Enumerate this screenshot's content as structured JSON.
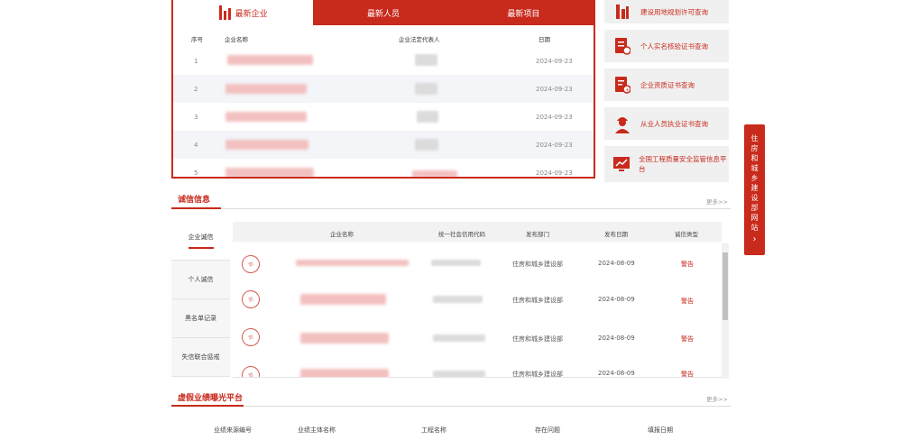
{
  "tabs": [
    {
      "label": "最新企业",
      "active": true
    },
    {
      "label": "最新人员",
      "active": false
    },
    {
      "label": "最新项目",
      "active": false
    }
  ],
  "latest_table": {
    "headers": {
      "no": "序号",
      "name": "企业名称",
      "rep": "企业法定代表人",
      "date": "日期"
    },
    "rows": [
      {
        "no": "1",
        "date": "2024-09-23"
      },
      {
        "no": "2",
        "date": "2024-09-23"
      },
      {
        "no": "3",
        "date": "2024-09-23"
      },
      {
        "no": "4",
        "date": "2024-09-23"
      },
      {
        "no": "5",
        "date": "2024-09-23"
      }
    ]
  },
  "side_cards": [
    {
      "text": "建设用地规划许可查询",
      "icon": "building-icon"
    },
    {
      "text": "个人实名核验证书查询",
      "icon": "id-card-icon"
    },
    {
      "text": "企业资质证书查询",
      "icon": "document-icon"
    },
    {
      "text": "从业人员执业证书查询",
      "icon": "worker-icon"
    },
    {
      "text": "全国工程质量安全监管信息平台",
      "icon": "chart-icon"
    }
  ],
  "float_tab": {
    "text": "住房和城乡建设部网站",
    "arrow": "›"
  },
  "credit": {
    "title": "诚信信息",
    "more": "更多>>",
    "nav": [
      "企业诚信",
      "个人诚信",
      "黑名单记录",
      "失信联合惩戒"
    ],
    "headers": {
      "name": "企业名称",
      "code": "统一社会信用代码",
      "dept": "发布部门",
      "date": "发布日期",
      "content": "诚信类型"
    },
    "rows": [
      {
        "dept": "住房和城乡建设部",
        "date": "2024-08-09",
        "content": "警告"
      },
      {
        "dept": "住房和城乡建设部",
        "date": "2024-08-09",
        "content": "警告"
      },
      {
        "dept": "住房和城乡建设部",
        "date": "2024-08-09",
        "content": "警告"
      },
      {
        "dept": "住房和城乡建设部",
        "date": "2024-08-09",
        "content": "警告"
      }
    ],
    "stamp_text": "罚"
  },
  "platform": {
    "title": "虚假业绩曝光平台",
    "more": "更多>>",
    "headers": [
      "业绩来源编号",
      "业绩主体名称",
      "工程名称",
      "存在问题",
      "填报日期"
    ]
  },
  "colors": {
    "accent": "#c82a1c"
  }
}
